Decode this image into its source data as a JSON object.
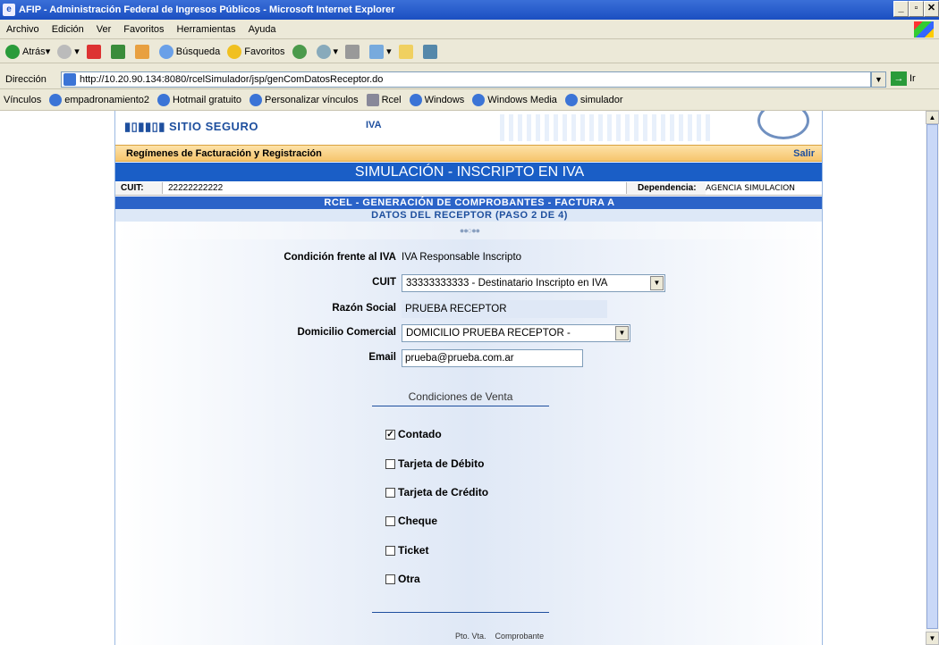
{
  "window": {
    "title": "AFIP - Administración Federal de Ingresos Públicos - Microsoft Internet Explorer"
  },
  "menu": [
    "Archivo",
    "Edición",
    "Ver",
    "Favoritos",
    "Herramientas",
    "Ayuda"
  ],
  "toolbar": {
    "back": "Atrás",
    "search": "Búsqueda",
    "favorites": "Favoritos"
  },
  "address": {
    "label": "Dirección",
    "url": "http://10.20.90.134:8080/rcelSimulador/jsp/genComDatosReceptor.do",
    "go": "Ir"
  },
  "links": {
    "label": "Vínculos",
    "items": [
      "empadronamiento2",
      "Hotmail gratuito",
      "Personalizar vínculos",
      "Rcel",
      "Windows",
      "Windows Media",
      "simulador"
    ]
  },
  "banner": {
    "sitio": "SITIO SEGURO",
    "iva": "IVA"
  },
  "header": {
    "regimenes": "Regímenes de Facturación y Registración",
    "salir": "Salir"
  },
  "simulacion": "SIMULACIÓN - INSCRIPTO EN IVA",
  "cuit_bar": {
    "cuit_label": "CUIT:",
    "cuit_value": "22222222222",
    "dep_label": "Dependencia:",
    "dep_value": "AGENCIA SIMULACION"
  },
  "rcel_title": "RCEL - GENERACIÓN DE COMPROBANTES - FACTURA A",
  "paso_title": "DATOS DEL RECEPTOR (PASO 2 DE 4)",
  "step_dots": "●●○●●",
  "form": {
    "condicion_label": "Condición frente al IVA",
    "condicion_value": "IVA Responsable Inscripto",
    "cuit_label": "CUIT",
    "cuit_value": "33333333333 - Destinatario Inscripto en IVA",
    "razon_label": "Razón Social",
    "razon_value": "PRUEBA RECEPTOR",
    "domicilio_label": "Domicilio Comercial",
    "domicilio_value": "DOMICILIO PRUEBA RECEPTOR -",
    "email_label": "Email",
    "email_value": "prueba@prueba.com.ar"
  },
  "condiciones": {
    "title": "Condiciones de Venta",
    "items": [
      {
        "label": "Contado",
        "checked": "✓"
      },
      {
        "label": "Tarjeta de Débito",
        "checked": ""
      },
      {
        "label": "Tarjeta de Crédito",
        "checked": ""
      },
      {
        "label": "Cheque",
        "checked": ""
      },
      {
        "label": "Ticket",
        "checked": ""
      },
      {
        "label": "Otra",
        "checked": ""
      }
    ]
  },
  "footer": {
    "pto_vta": "Pto. Vta.",
    "comprobante": "Comprobante"
  },
  "colors": {
    "accent": "#1a5ec6",
    "orange": "#f6c56d",
    "panel": "#dfe8f6"
  }
}
